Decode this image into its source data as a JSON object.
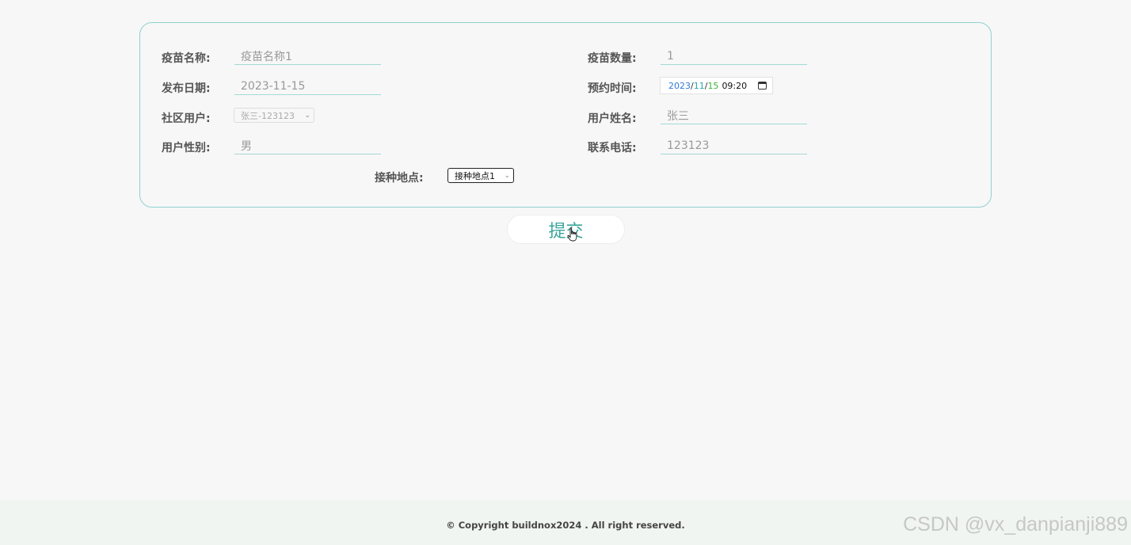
{
  "form": {
    "vaccine_name": {
      "label": "疫苗名称:",
      "value": "疫苗名称1"
    },
    "vaccine_quantity": {
      "label": "疫苗数量:",
      "value": "1"
    },
    "publish_date": {
      "label": "发布日期:",
      "value": "2023-11-15"
    },
    "appointment_time": {
      "label": "预约时间:",
      "year": "2023",
      "month": "11",
      "day": "15",
      "sep": "/",
      "time": "09:20"
    },
    "community_user": {
      "label": "社区用户:",
      "value": "张三-123123"
    },
    "user_name": {
      "label": "用户姓名:",
      "value": "张三"
    },
    "user_gender": {
      "label": "用户性别:",
      "value": "男"
    },
    "contact_phone": {
      "label": "联系电话:",
      "value": "123123"
    },
    "vaccination_site": {
      "label": "接种地点:",
      "value": "接种地点1"
    }
  },
  "submit_label": "提交",
  "footer": {
    "copyright": "© Copyright buildnox2024 . All right reserved."
  },
  "watermark": "CSDN @vx_danpianji889",
  "colors": {
    "panel_border": "#8fd2cd",
    "accent": "#3aa59a",
    "background": "#f7f7f7"
  }
}
